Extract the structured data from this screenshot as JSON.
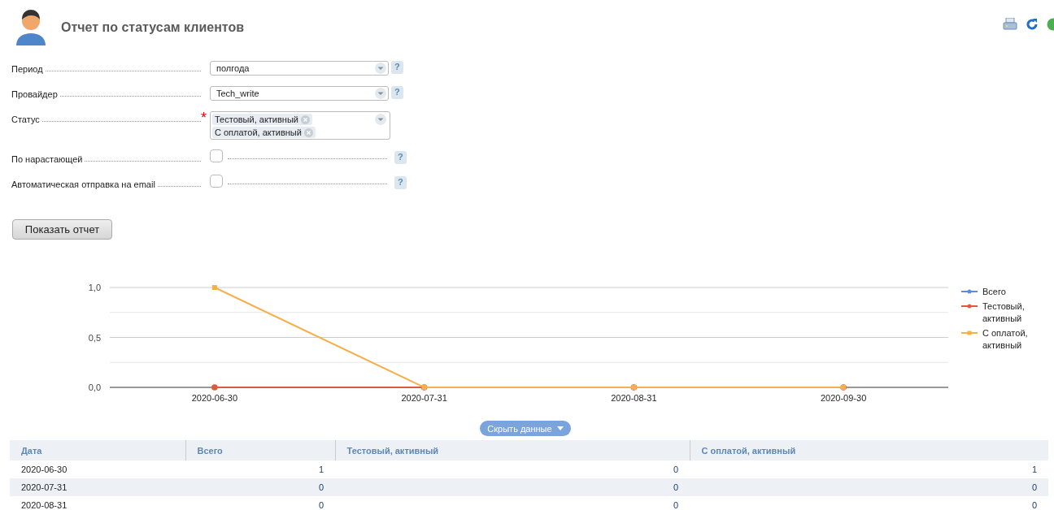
{
  "header": {
    "title": "Отчет по статусам клиентов"
  },
  "form": {
    "fields": [
      {
        "kind": "select",
        "label": "Период",
        "value": "полгода",
        "required": false
      },
      {
        "kind": "select",
        "label": "Провайдер",
        "value": "Tech_write",
        "required": false
      },
      {
        "kind": "multiselect",
        "label": "Статус",
        "required": true,
        "tags": [
          "Тестовый, активный",
          "С оплатой, активный"
        ]
      },
      {
        "kind": "checkbox",
        "label": "По нарастающей",
        "checked": false,
        "required": false
      },
      {
        "kind": "checkbox",
        "label": "Автоматическая отправка на email",
        "checked": false,
        "required": false
      }
    ],
    "required_mark": "*",
    "help": "?",
    "submit": "Показать отчет"
  },
  "chart": {
    "chart_data": {
      "type": "line",
      "categories": [
        "2020-06-30",
        "2020-07-31",
        "2020-08-31",
        "2020-09-30"
      ],
      "series": [
        {
          "name": "Всего",
          "color": "#5b8dd9",
          "marker": "circle",
          "values": [
            null,
            null,
            null,
            null
          ]
        },
        {
          "name": "Тестовый, активный",
          "color": "#e0593b",
          "marker": "circle",
          "values": [
            0,
            0,
            0,
            0
          ]
        },
        {
          "name": "С оплатой, активный",
          "color": "#f5b04e",
          "marker": "square",
          "values": [
            1,
            0,
            0,
            0
          ]
        }
      ],
      "ref_lines": [
        {
          "axis": "y",
          "value": 0.25
        },
        {
          "axis": "y",
          "value": 0.75
        }
      ],
      "ylim": [
        0,
        1
      ],
      "yticks": [
        {
          "value": 0,
          "label": "0,0"
        },
        {
          "value": 0.5,
          "label": "0,5"
        },
        {
          "value": 1,
          "label": "1,0"
        }
      ]
    }
  },
  "toggle": "Скрыть данные",
  "table": {
    "columns": [
      "Дата",
      "Всего",
      "Тестовый, активный",
      "С оплатой, активный"
    ],
    "rows": [
      [
        "2020-06-30",
        "1",
        "0",
        "1"
      ],
      [
        "2020-07-31",
        "0",
        "0",
        "0"
      ],
      [
        "2020-08-31",
        "0",
        "0",
        "0"
      ]
    ]
  }
}
